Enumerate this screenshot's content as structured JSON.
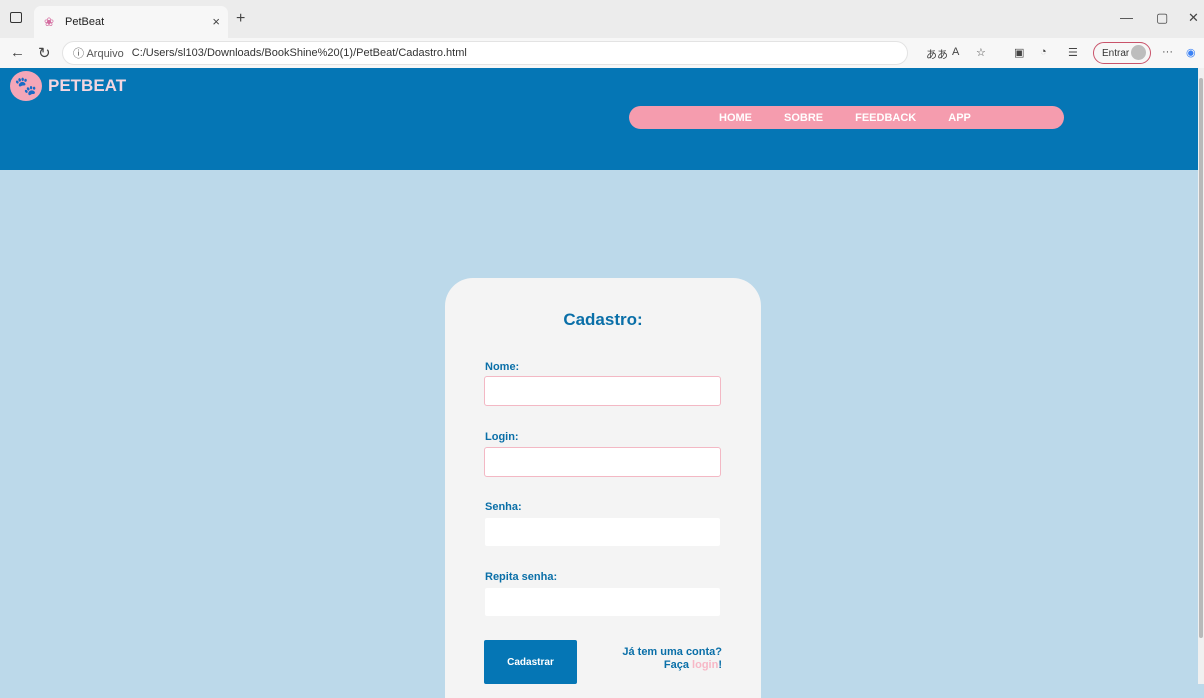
{
  "browser": {
    "tab_title": "PetBeat",
    "tab_close": "×",
    "new_tab": "+",
    "url_label": "ⓘ Arquivo",
    "url": "C:/Users/sl103/Downloads/BookShine%20(1)/PetBeat/Cadastro.html",
    "entrar_label": "Entrar",
    "more": "···"
  },
  "header": {
    "brand": "PETBEAT",
    "nav": [
      {
        "label": "HOME"
      },
      {
        "label": "SOBRE"
      },
      {
        "label": "FEEDBACK"
      },
      {
        "label": "APP"
      }
    ]
  },
  "form": {
    "title": "Cadastro:",
    "fields": [
      {
        "label": "Nome:",
        "value": ""
      },
      {
        "label": "Login:",
        "value": ""
      },
      {
        "label": "Senha:",
        "value": ""
      },
      {
        "label": "Repita senha:",
        "value": ""
      }
    ],
    "submit_label": "Cadastrar",
    "hint_line1": "Já tem uma conta?",
    "hint_prefix": "Faça ",
    "hint_link": "login",
    "hint_suffix": "!"
  },
  "colors": {
    "header": "#0576b5",
    "page_bg": "#bcd9ea",
    "nav_pill": "#f59cae",
    "card": "#f4f4f4",
    "accent_text": "#0a6fa8"
  }
}
